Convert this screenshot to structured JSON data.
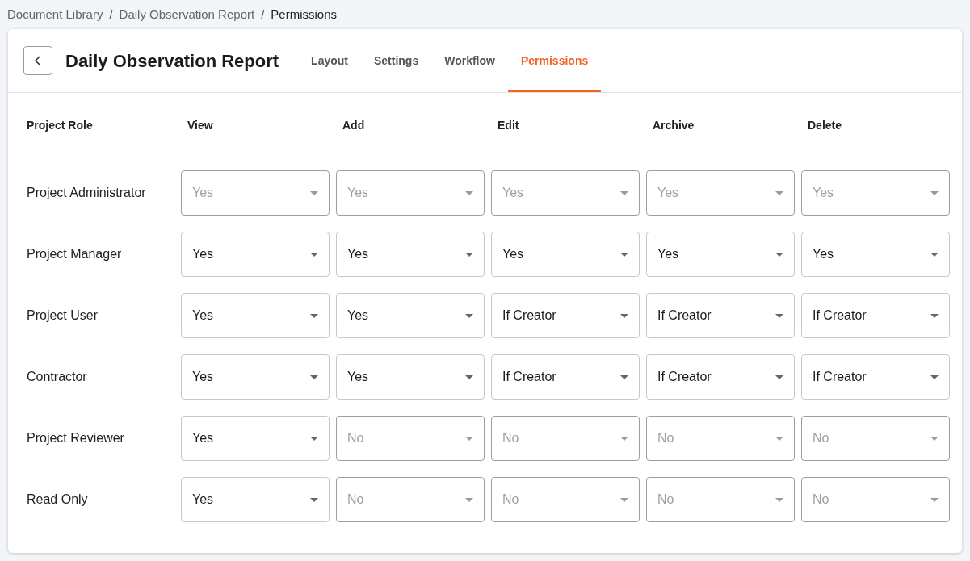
{
  "breadcrumb": [
    {
      "label": "Document Library",
      "current": false
    },
    {
      "label": "Daily Observation Report",
      "current": false
    },
    {
      "label": "Permissions",
      "current": true
    }
  ],
  "breadcrumb_separator": "/",
  "title": "Daily Observation Report",
  "tabs": [
    {
      "label": "Layout",
      "selected": false
    },
    {
      "label": "Settings",
      "selected": false
    },
    {
      "label": "Workflow",
      "selected": false
    },
    {
      "label": "Permissions",
      "selected": true
    }
  ],
  "table": {
    "columns": [
      "Project Role",
      "View",
      "Add",
      "Edit",
      "Archive",
      "Delete"
    ],
    "rows": [
      {
        "cells": [
          {
            "kind": "label",
            "value": "Project Administrator"
          },
          {
            "kind": "dropdown",
            "value": "Yes",
            "disabled": true
          },
          {
            "kind": "dropdown",
            "value": "Yes",
            "disabled": true
          },
          {
            "kind": "dropdown",
            "value": "Yes",
            "disabled": true
          },
          {
            "kind": "dropdown",
            "value": "Yes",
            "disabled": true
          },
          {
            "kind": "dropdown",
            "value": "Yes",
            "disabled": true
          }
        ]
      },
      {
        "cells": [
          {
            "kind": "label",
            "value": "Project Manager"
          },
          {
            "kind": "dropdown",
            "value": "Yes",
            "disabled": false
          },
          {
            "kind": "dropdown",
            "value": "Yes",
            "disabled": false
          },
          {
            "kind": "dropdown",
            "value": "Yes",
            "disabled": false
          },
          {
            "kind": "dropdown",
            "value": "Yes",
            "disabled": false
          },
          {
            "kind": "dropdown",
            "value": "Yes",
            "disabled": false
          }
        ]
      },
      {
        "cells": [
          {
            "kind": "label",
            "value": "Project User"
          },
          {
            "kind": "dropdown",
            "value": "Yes",
            "disabled": false
          },
          {
            "kind": "dropdown",
            "value": "Yes",
            "disabled": false
          },
          {
            "kind": "dropdown",
            "value": "If Creator",
            "disabled": false
          },
          {
            "kind": "dropdown",
            "value": "If Creator",
            "disabled": false
          },
          {
            "kind": "dropdown",
            "value": "If Creator",
            "disabled": false
          }
        ]
      },
      {
        "cells": [
          {
            "kind": "label",
            "value": "Contractor"
          },
          {
            "kind": "dropdown",
            "value": "Yes",
            "disabled": false
          },
          {
            "kind": "dropdown",
            "value": "Yes",
            "disabled": false
          },
          {
            "kind": "dropdown",
            "value": "If Creator",
            "disabled": false
          },
          {
            "kind": "dropdown",
            "value": "If Creator",
            "disabled": false
          },
          {
            "kind": "dropdown",
            "value": "If Creator",
            "disabled": false
          }
        ]
      },
      {
        "cells": [
          {
            "kind": "label",
            "value": "Project Reviewer"
          },
          {
            "kind": "dropdown",
            "value": "Yes",
            "disabled": false
          },
          {
            "kind": "dropdown",
            "value": "No",
            "disabled": true
          },
          {
            "kind": "dropdown",
            "value": "No",
            "disabled": true
          },
          {
            "kind": "dropdown",
            "value": "No",
            "disabled": true
          },
          {
            "kind": "dropdown",
            "value": "No",
            "disabled": true
          }
        ]
      },
      {
        "cells": [
          {
            "kind": "label",
            "value": "Read Only"
          },
          {
            "kind": "dropdown",
            "value": "Yes",
            "disabled": false
          },
          {
            "kind": "dropdown",
            "value": "No",
            "disabled": true
          },
          {
            "kind": "dropdown",
            "value": "No",
            "disabled": true
          },
          {
            "kind": "dropdown",
            "value": "No",
            "disabled": true
          },
          {
            "kind": "dropdown",
            "value": "No",
            "disabled": true
          }
        ]
      }
    ]
  }
}
